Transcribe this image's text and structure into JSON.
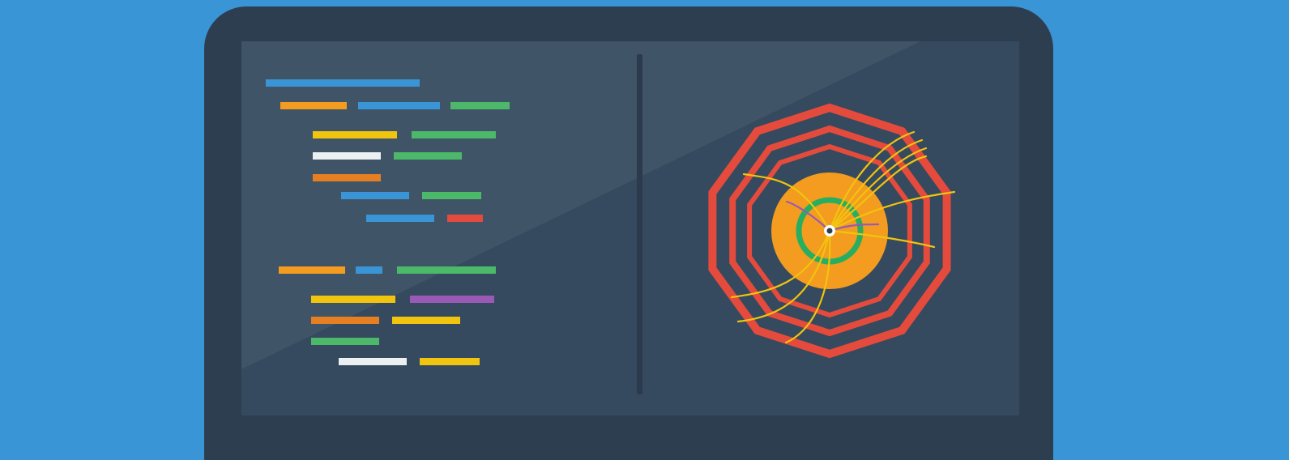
{
  "illustration": {
    "subject": "laptop-code-and-particle-collision",
    "colors": {
      "background": "#3a95d6",
      "laptop_body": "#2e3e51",
      "screen": "#354a5e",
      "divider": "#2b3b4d",
      "detector_red": "#e54b3c",
      "detector_orange": "#f39c1f",
      "detector_green": "#27ae60",
      "track_yellow": "#f1c40f",
      "track_purple": "#9b59b6",
      "vertex_white": "#ffffff"
    },
    "code_palette": {
      "blue": "#3a95d6",
      "orange": "#f39c1f",
      "green": "#4cb86a",
      "yellow": "#f1c40f",
      "white": "#ecf0f1",
      "dark_orange": "#e67e22",
      "red": "#e54b3c",
      "purple": "#9b59b6"
    }
  }
}
